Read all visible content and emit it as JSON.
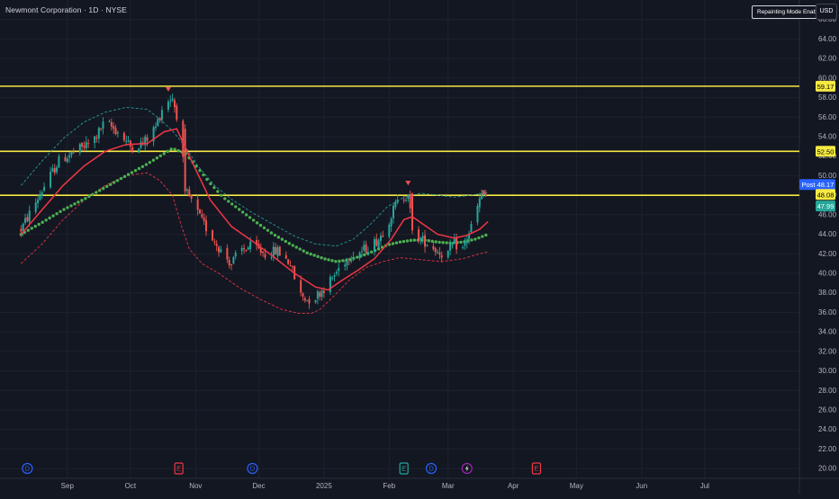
{
  "header": {
    "symbol_title": "Newmont Corporation · 1D · NYSE",
    "mode_badge": "Repainting Mode Enabled",
    "currency": "USD"
  },
  "colors": {
    "background": "#131722",
    "grid": "#1e222d",
    "up": "#26a69a",
    "down": "#ef5350",
    "level_line": "#f5e942",
    "ma_line": "#f23645",
    "band_upper": "#26a69a",
    "band_lower": "#f23645",
    "dotted_ma": "#4caf50",
    "post_badge": "#2962ff"
  },
  "chart_data": {
    "type": "candlestick",
    "y_axis": {
      "ylim": [
        19,
        68
      ],
      "ticks": [
        "66.00",
        "64.00",
        "62.00",
        "60.00",
        "58.00",
        "56.00",
        "54.00",
        "52.00",
        "50.00",
        "48.00",
        "46.00",
        "44.00",
        "42.00",
        "40.00",
        "38.00",
        "36.00",
        "34.00",
        "32.00",
        "30.00",
        "28.00",
        "26.00",
        "24.00",
        "22.00",
        "20.00"
      ]
    },
    "x_axis": {
      "labels": [
        {
          "label": "Sep",
          "day": 22
        },
        {
          "label": "Oct",
          "day": 52
        },
        {
          "label": "Nov",
          "day": 83
        },
        {
          "label": "Dec",
          "day": 113
        },
        {
          "label": "2025",
          "day": 144
        },
        {
          "label": "Feb",
          "day": 175
        },
        {
          "label": "Mar",
          "day": 203
        },
        {
          "label": "Apr",
          "day": 234
        },
        {
          "label": "May",
          "day": 264
        },
        {
          "label": "Jun",
          "day": 295
        },
        {
          "label": "Jul",
          "day": 325
        }
      ],
      "range_days": [
        -10,
        370
      ]
    },
    "horizontal_levels": [
      {
        "price": 59.17,
        "label": "59.17"
      },
      {
        "price": 52.5,
        "label": "52.50"
      },
      {
        "price": 48.0,
        "label": ""
      }
    ],
    "price_labels": [
      {
        "text": "59.17",
        "price": 59.17,
        "style": "level"
      },
      {
        "text": "52.50",
        "price": 52.5,
        "style": "level"
      },
      {
        "text": "Post",
        "price": 49.1,
        "style": "post"
      },
      {
        "text": "48.17",
        "price": 49.1,
        "style": "post-value"
      },
      {
        "text": "48.08",
        "price": 48.08,
        "style": "level"
      },
      {
        "text": "47.99",
        "price": 46.9,
        "style": "last"
      }
    ],
    "ohlc_key_points": [
      [
        0,
        44.5
      ],
      [
        10,
        48.5
      ],
      [
        18,
        51.5
      ],
      [
        26,
        52.5
      ],
      [
        34,
        53.5
      ],
      [
        40,
        55.5
      ],
      [
        46,
        54.5
      ],
      [
        52,
        53.0
      ],
      [
        58,
        53.3
      ],
      [
        64,
        55.0
      ],
      [
        68,
        57.5
      ],
      [
        72,
        58.0
      ],
      [
        76,
        54.5
      ],
      [
        78,
        48.5
      ],
      [
        82,
        47.0
      ],
      [
        86,
        45.3
      ],
      [
        90,
        44.0
      ],
      [
        96,
        42.0
      ],
      [
        100,
        41.0
      ],
      [
        104,
        42.3
      ],
      [
        110,
        42.8
      ],
      [
        116,
        42.0
      ],
      [
        122,
        42.3
      ],
      [
        128,
        41.0
      ],
      [
        132,
        38.0
      ],
      [
        136,
        37.3
      ],
      [
        140,
        37.6
      ],
      [
        144,
        38.5
      ],
      [
        148,
        39.5
      ],
      [
        152,
        40.8
      ],
      [
        156,
        41.8
      ],
      [
        162,
        42.3
      ],
      [
        166,
        42.8
      ],
      [
        170,
        43.5
      ],
      [
        174,
        45.0
      ],
      [
        178,
        47.0
      ],
      [
        182,
        47.8
      ],
      [
        184,
        48.3
      ],
      [
        186,
        44.3
      ],
      [
        190,
        43.5
      ],
      [
        194,
        43.0
      ],
      [
        198,
        42.3
      ],
      [
        202,
        41.8
      ],
      [
        206,
        43.0
      ],
      [
        210,
        42.5
      ],
      [
        214,
        44.8
      ],
      [
        216,
        46.0
      ],
      [
        218,
        47.5
      ],
      [
        220,
        48.1
      ],
      [
        222,
        47.99
      ]
    ],
    "trading_days_end": 222,
    "ma_red": [
      [
        0,
        44.0
      ],
      [
        10,
        46.5
      ],
      [
        20,
        49.0
      ],
      [
        30,
        51.0
      ],
      [
        40,
        52.5
      ],
      [
        50,
        53.2
      ],
      [
        60,
        53.3
      ],
      [
        68,
        54.5
      ],
      [
        74,
        54.8
      ],
      [
        80,
        52.0
      ],
      [
        90,
        47.5
      ],
      [
        100,
        44.8
      ],
      [
        110,
        43.3
      ],
      [
        120,
        41.7
      ],
      [
        130,
        40.0
      ],
      [
        140,
        38.6
      ],
      [
        146,
        38.3
      ],
      [
        152,
        39.2
      ],
      [
        160,
        40.3
      ],
      [
        168,
        41.5
      ],
      [
        176,
        43.5
      ],
      [
        182,
        45.5
      ],
      [
        186,
        45.8
      ],
      [
        192,
        44.9
      ],
      [
        198,
        44.0
      ],
      [
        206,
        43.6
      ],
      [
        212,
        43.9
      ],
      [
        218,
        44.5
      ],
      [
        222,
        45.3
      ]
    ],
    "band_upper": [
      [
        0,
        49.0
      ],
      [
        10,
        51.5
      ],
      [
        20,
        53.8
      ],
      [
        30,
        55.5
      ],
      [
        40,
        56.5
      ],
      [
        50,
        57.0
      ],
      [
        60,
        56.8
      ],
      [
        66,
        55.8
      ],
      [
        72,
        54.6
      ],
      [
        78,
        53.0
      ],
      [
        84,
        51.0
      ],
      [
        92,
        49.0
      ],
      [
        100,
        47.6
      ],
      [
        110,
        46.2
      ],
      [
        120,
        45.0
      ],
      [
        130,
        43.8
      ],
      [
        140,
        43.0
      ],
      [
        150,
        42.8
      ],
      [
        158,
        43.5
      ],
      [
        166,
        45.0
      ],
      [
        174,
        46.8
      ],
      [
        182,
        47.8
      ],
      [
        190,
        48.2
      ],
      [
        198,
        48.0
      ],
      [
        206,
        47.8
      ],
      [
        214,
        48.0
      ],
      [
        222,
        48.3
      ]
    ],
    "band_lower": [
      [
        0,
        41.0
      ],
      [
        10,
        43.0
      ],
      [
        20,
        45.5
      ],
      [
        30,
        47.5
      ],
      [
        40,
        49.0
      ],
      [
        50,
        50.0
      ],
      [
        60,
        50.3
      ],
      [
        66,
        49.5
      ],
      [
        72,
        48.0
      ],
      [
        76,
        45.0
      ],
      [
        80,
        42.5
      ],
      [
        86,
        41.0
      ],
      [
        94,
        40.0
      ],
      [
        104,
        38.5
      ],
      [
        114,
        37.3
      ],
      [
        124,
        36.3
      ],
      [
        132,
        35.9
      ],
      [
        138,
        35.9
      ],
      [
        142,
        36.3
      ],
      [
        148,
        37.5
      ],
      [
        156,
        39.3
      ],
      [
        164,
        40.6
      ],
      [
        172,
        41.2
      ],
      [
        180,
        41.6
      ],
      [
        190,
        41.4
      ],
      [
        200,
        41.2
      ],
      [
        210,
        41.5
      ],
      [
        218,
        42.0
      ],
      [
        222,
        42.2
      ]
    ],
    "ma_dotted": [
      [
        0,
        44.0
      ],
      [
        10,
        45.2
      ],
      [
        20,
        46.5
      ],
      [
        30,
        47.6
      ],
      [
        40,
        48.8
      ],
      [
        50,
        50.0
      ],
      [
        60,
        51.2
      ],
      [
        66,
        52.0
      ],
      [
        72,
        52.8
      ],
      [
        78,
        52.3
      ],
      [
        84,
        50.8
      ],
      [
        90,
        49.2
      ],
      [
        96,
        47.8
      ],
      [
        104,
        46.5
      ],
      [
        112,
        45.2
      ],
      [
        120,
        44.0
      ],
      [
        128,
        43.0
      ],
      [
        136,
        42.1
      ],
      [
        144,
        41.5
      ],
      [
        150,
        41.2
      ],
      [
        156,
        41.4
      ],
      [
        162,
        41.8
      ],
      [
        168,
        42.3
      ],
      [
        174,
        42.9
      ],
      [
        180,
        43.2
      ],
      [
        186,
        43.4
      ],
      [
        192,
        43.4
      ],
      [
        198,
        43.2
      ],
      [
        204,
        43.1
      ],
      [
        210,
        43.2
      ],
      [
        216,
        43.5
      ],
      [
        222,
        44.0
      ]
    ],
    "markers": [
      {
        "type": "down-arrow",
        "day": 70,
        "price": 58.8,
        "color": "#ef5350"
      },
      {
        "type": "down-arrow",
        "day": 184,
        "price": 49.2,
        "color": "#ef5350"
      },
      {
        "type": "x-cross",
        "day": 220,
        "price": 48.3,
        "color": "#ef5350"
      }
    ],
    "events": [
      {
        "label": "D",
        "day": 3,
        "kind": "dividend"
      },
      {
        "label": "E",
        "day": 75,
        "kind": "earnings-negative"
      },
      {
        "label": "D",
        "day": 110,
        "kind": "dividend"
      },
      {
        "label": "E",
        "day": 182,
        "kind": "earnings-positive"
      },
      {
        "label": "D",
        "day": 195,
        "kind": "dividend"
      },
      {
        "label": "",
        "day": 212,
        "kind": "split-flash"
      },
      {
        "label": "E",
        "day": 245,
        "kind": "earnings-negative"
      }
    ]
  }
}
